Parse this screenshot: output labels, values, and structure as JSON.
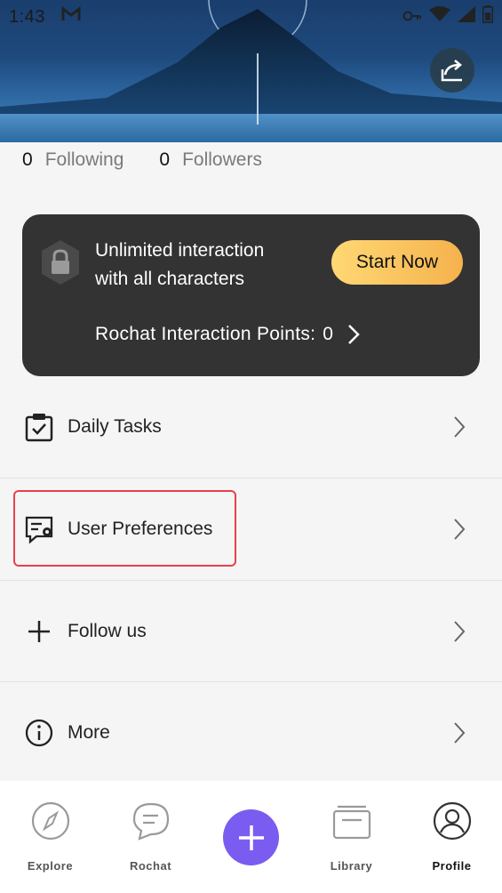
{
  "status_bar": {
    "time": "1:43",
    "mail_icon": "gmail-icon",
    "icons": [
      "vpn-key-icon",
      "wifi-icon",
      "signal-icon",
      "battery-icon"
    ]
  },
  "header": {
    "share_icon": "share-icon"
  },
  "stats": {
    "following_count": "0",
    "following_label": "Following",
    "followers_count": "0",
    "followers_label": "Followers"
  },
  "promo": {
    "line1": "Unlimited interaction",
    "line2": "with all characters",
    "start_label": "Start Now",
    "points_label": "Rochat Interaction Points:",
    "points_value": "0",
    "accent_start": "#ffd874",
    "accent_end": "#f5b24d"
  },
  "menu": {
    "items": [
      {
        "label": "Daily Tasks",
        "icon": "clipboard-check-icon"
      },
      {
        "label": "User Preferences",
        "icon": "chat-settings-icon"
      },
      {
        "label": "Follow us",
        "icon": "plus-icon"
      },
      {
        "label": "More",
        "icon": "info-icon"
      }
    ]
  },
  "bottom_nav": {
    "items": [
      {
        "label": "Explore",
        "icon": "compass-icon"
      },
      {
        "label": "Rochat",
        "icon": "chat-bubble-icon"
      },
      {
        "label": "",
        "icon": "plus-icon"
      },
      {
        "label": "Library",
        "icon": "library-icon"
      },
      {
        "label": "Profile",
        "icon": "profile-icon"
      }
    ],
    "fab_color": "#7b5cf0"
  },
  "colors": {
    "highlight": "#e8414a",
    "promo_bg": "#333333"
  }
}
